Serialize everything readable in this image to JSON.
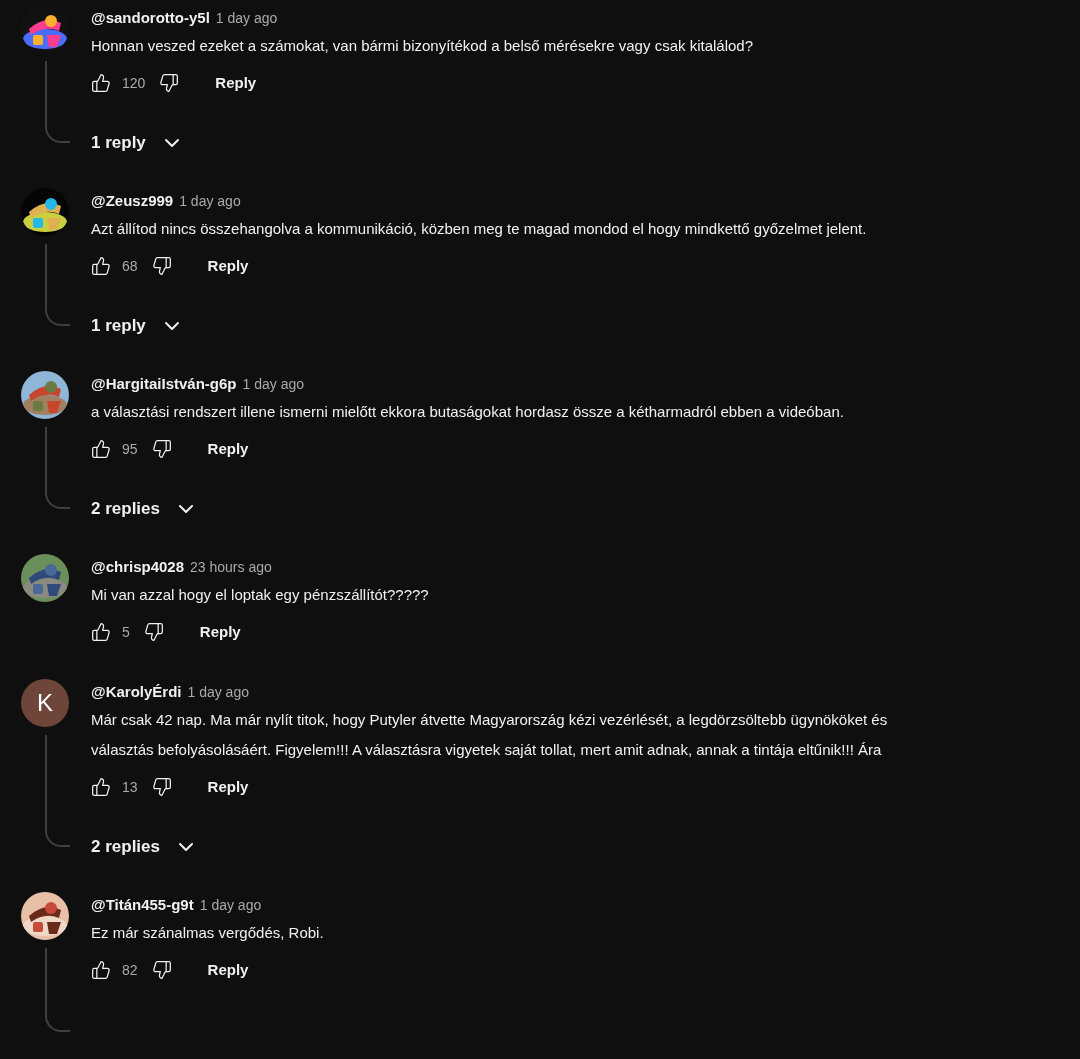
{
  "comments": [
    {
      "author": "@sandorotto-y5l",
      "time": "1 day ago",
      "avatar": {
        "kind": "picture"
      },
      "lines": [
        "Honnan veszed ezeket a számokat, van bármi bizonyítékod a belső mérésekre vagy csak kitalálod?"
      ],
      "likes": "120",
      "reply_button": "Reply",
      "has_replies": true,
      "replies_label": "1 reply"
    },
    {
      "author": "@Zeusz999",
      "time": "1 day ago",
      "avatar": {
        "kind": "picture"
      },
      "lines": [
        "Azt állítod nincs összehangolva a kommunikáció, közben meg te magad mondod el hogy mindkettő győzelmet jelent."
      ],
      "likes": "68",
      "reply_button": "Reply",
      "has_replies": true,
      "replies_label": "1 reply"
    },
    {
      "author": "@HargitaiIstván-g6p",
      "time": "1 day ago",
      "avatar": {
        "kind": "picture"
      },
      "lines": [
        "a választási rendszert illene ismerni mielőtt ekkora butaságokat hordasz össze a kétharmadról ebben a videóban."
      ],
      "likes": "95",
      "reply_button": "Reply",
      "has_replies": true,
      "replies_label": "2 replies"
    },
    {
      "author": "@chrisp4028",
      "time": "23 hours ago",
      "avatar": {
        "kind": "picture"
      },
      "lines": [
        "Mi van azzal hogy el loptak egy pénzszállítót?????"
      ],
      "likes": "5",
      "reply_button": "Reply",
      "has_replies": false
    },
    {
      "author": "@KarolyÉrdi",
      "time": "1 day ago",
      "avatar": {
        "kind": "letter",
        "letter": "K",
        "color": "#6d4539"
      },
      "lines": [
        "Már csak 42 nap. Ma már nylít titok, hogy Putyler átvette Magyarország kézi vezérlését, a legdörzsöltebb ügynököket és",
        "választás befolyásolásáért. Figyelem!!! A választásra vigyetek saját tollat, mert amit adnak, annak a tintája eltűnik!!! Ára"
      ],
      "likes": "13",
      "reply_button": "Reply",
      "has_replies": true,
      "replies_label": "2 replies"
    },
    {
      "author": "@Titán455-g9t",
      "time": "1 day ago",
      "avatar": {
        "kind": "picture"
      },
      "lines": [
        "Ez már szánalmas vergődés, Robi."
      ],
      "likes": "82",
      "reply_button": "Reply",
      "has_replies": true
    }
  ]
}
